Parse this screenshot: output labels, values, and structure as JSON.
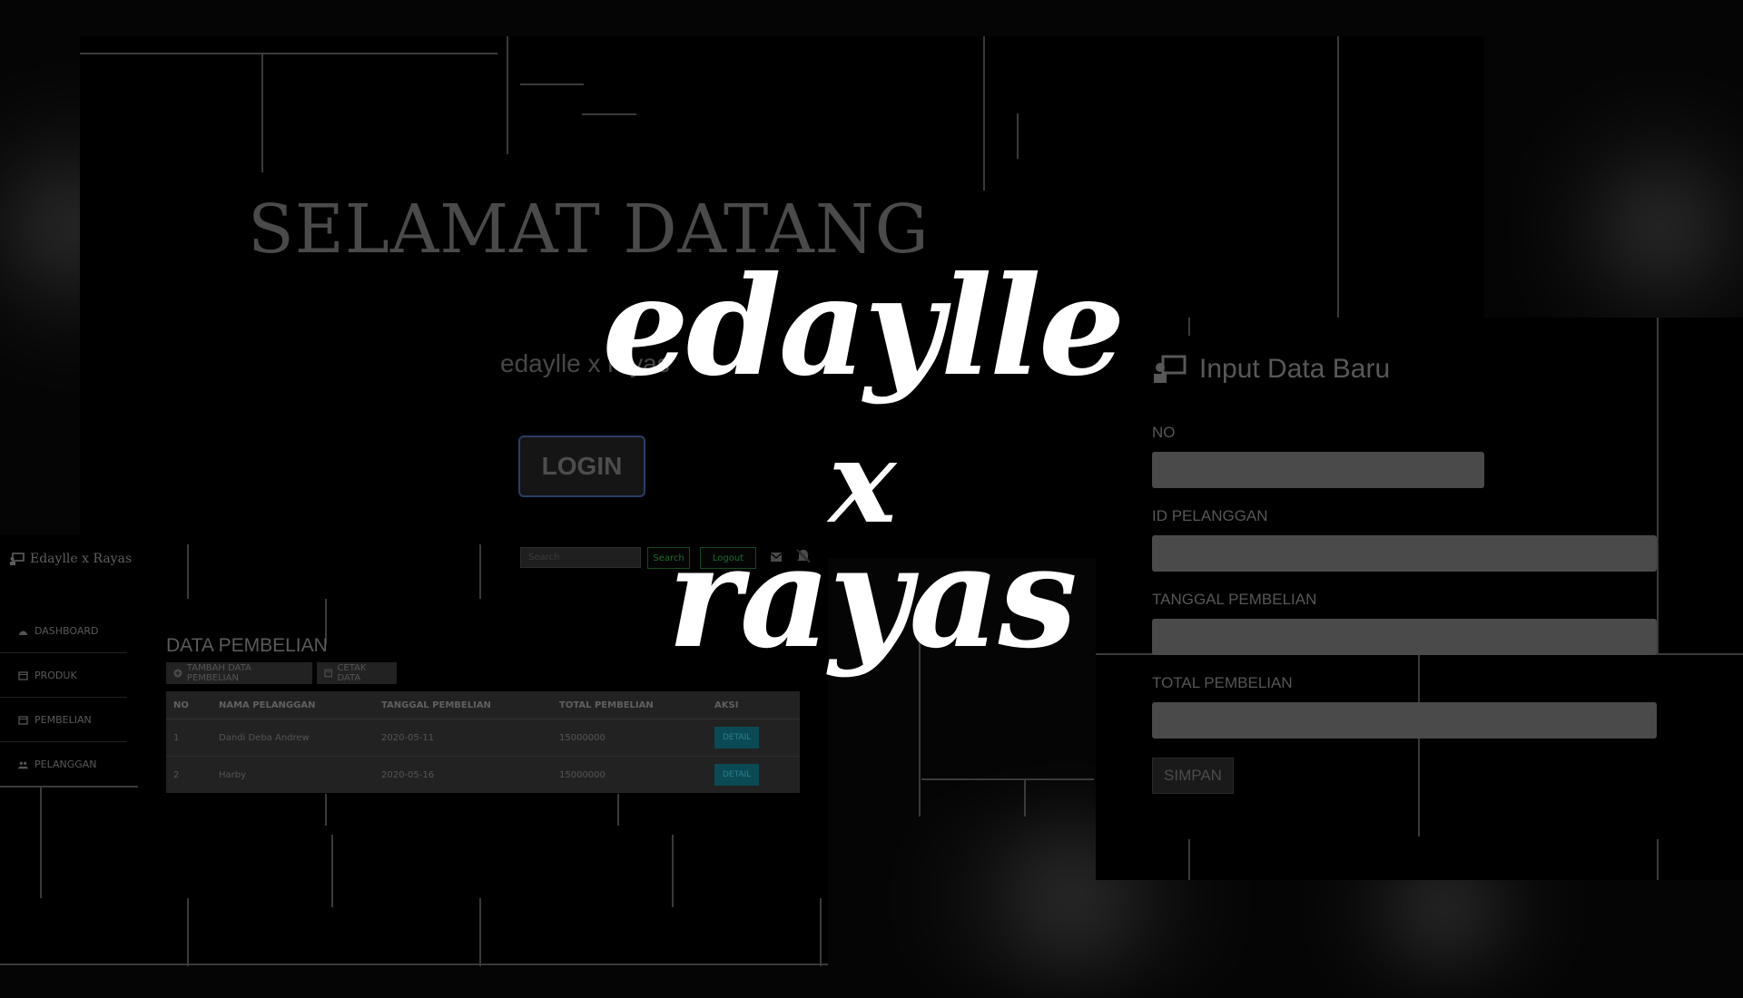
{
  "welcome": {
    "title": "SELAMAT DATANG",
    "brand": "edaylle x rayas",
    "login_label": "LOGIN"
  },
  "dashboard": {
    "brand": "Edaylle x Rayas",
    "search_placeholder": "Search",
    "search_button": "Search",
    "logout_button": "Logout",
    "sidebar": [
      {
        "label": "DASHBOARD",
        "icon": "dashboard-icon"
      },
      {
        "label": "PRODUK",
        "icon": "calendar-icon"
      },
      {
        "label": "PEMBELIAN",
        "icon": "calendar-icon"
      },
      {
        "label": "PELANGGAN",
        "icon": "users-icon"
      }
    ],
    "title": "DATA PEMBELIAN",
    "add_button": "TAMBAH DATA PEMBELIAN",
    "print_button": "CETAK DATA",
    "table": {
      "headers": [
        "NO",
        "NAMA PELANGGAN",
        "TANGGAL PEMBELIAN",
        "TOTAL PEMBELIAN",
        "AKSI"
      ],
      "rows": [
        {
          "no": "1",
          "nama": "Dandi Deba Andrew",
          "tanggal": "2020-05-11",
          "total": "15000000",
          "aksi": "DETAIL"
        },
        {
          "no": "2",
          "nama": "Harby",
          "tanggal": "2020-05-16",
          "total": "15000000",
          "aksi": "DETAIL"
        }
      ]
    }
  },
  "form": {
    "title": "Input Data Baru",
    "fields": [
      {
        "label": "NO"
      },
      {
        "label": "ID PELANGGAN"
      },
      {
        "label": "TANGGAL PEMBELIAN"
      },
      {
        "label": "TOTAL PEMBELIAN"
      }
    ],
    "save_label": "SIMPAN"
  },
  "overlay": {
    "line1": "edaylle",
    "line2": "x",
    "line3": "rayas"
  },
  "colors": {
    "background": "#050505",
    "overlay_text": "#ffffff",
    "login_border": "#2a3d66",
    "detail_button": "#0b4a55",
    "green_button": "#1c6d2a"
  }
}
